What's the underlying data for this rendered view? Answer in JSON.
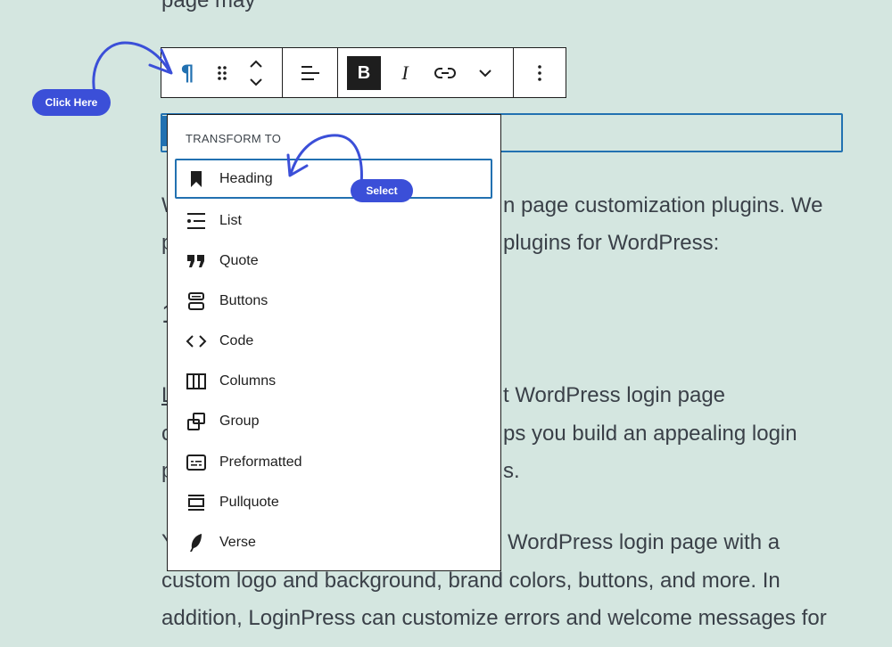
{
  "background_text": {
    "top_fragment": "page may",
    "line1_right": "n page customization plugins. We",
    "line2_right": "plugins for WordPress:",
    "line3_right": "t WordPress login page",
    "line4_right": "ps you build an appealing login",
    "line5_right": "s.",
    "line6_right": "WordPress login page with a",
    "line7": "custom logo and background, brand colors, buttons, and more. In",
    "line8": "addition, LoginPress can customize errors and welcome messages for",
    "frag_w": "W",
    "frag_p": "p",
    "frag_one": "1",
    "frag_L": "L",
    "frag_c": "c",
    "frag_p2": "p",
    "frag_Y": "Y"
  },
  "toolbar": {
    "paragraph_icon": "pilcrow-icon",
    "drag_icon": "drag-handle-icon",
    "move_icon": "move-up-down-icon",
    "align_icon": "align-left-icon",
    "bold_label": "B",
    "italic_label": "I",
    "link_icon": "link-icon",
    "more_icon": "chevron-down-icon",
    "options_icon": "more-vertical-icon"
  },
  "popover": {
    "title": "TRANSFORM TO",
    "items": [
      {
        "label": "Heading",
        "icon": "bookmark-icon"
      },
      {
        "label": "List",
        "icon": "list-icon"
      },
      {
        "label": "Quote",
        "icon": "quote-icon"
      },
      {
        "label": "Buttons",
        "icon": "buttons-icon"
      },
      {
        "label": "Code",
        "icon": "code-icon"
      },
      {
        "label": "Columns",
        "icon": "columns-icon"
      },
      {
        "label": "Group",
        "icon": "group-icon"
      },
      {
        "label": "Preformatted",
        "icon": "preformatted-icon"
      },
      {
        "label": "Pullquote",
        "icon": "pullquote-icon"
      },
      {
        "label": "Verse",
        "icon": "verse-icon"
      }
    ]
  },
  "annotations": {
    "click_here": "Click Here",
    "select": "Select"
  },
  "colors": {
    "background": "#d4e6e0",
    "accent": "#2271b1",
    "annotation": "#3b4fd8"
  }
}
